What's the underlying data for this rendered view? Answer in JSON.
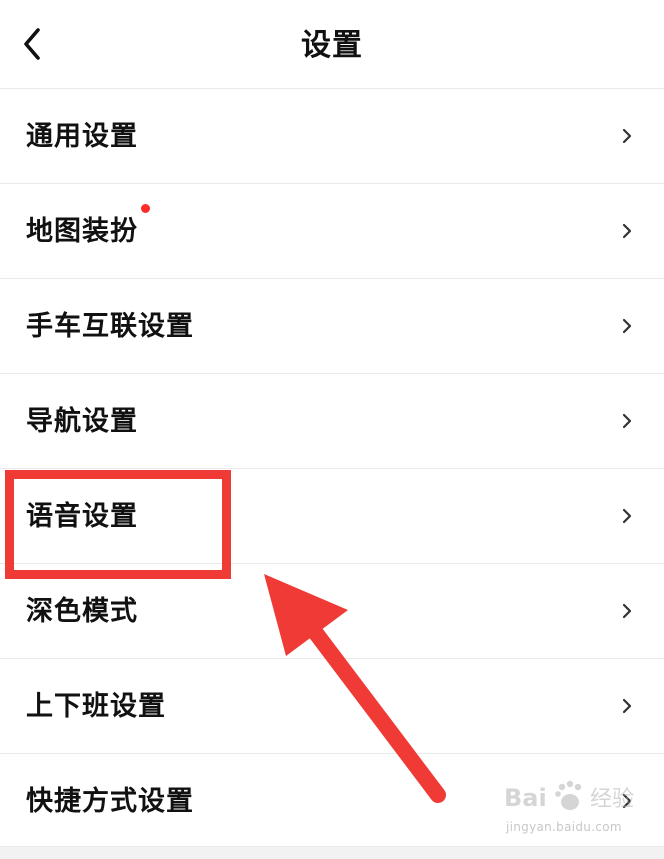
{
  "header": {
    "title": "设置"
  },
  "menu": {
    "items": [
      {
        "label": "通用设置"
      },
      {
        "label": "地图装扮",
        "has_dot": true
      },
      {
        "label": "手车互联设置"
      },
      {
        "label": "导航设置"
      },
      {
        "label": "语音设置"
      },
      {
        "label": "深色模式"
      },
      {
        "label": "上下班设置"
      },
      {
        "label": "快捷方式设置"
      }
    ]
  },
  "annotation": {
    "highlight_color": "#f03a35",
    "highlighted_item": "语音设置"
  },
  "watermark": {
    "logo_text": "Baidu 经验",
    "url": "jingyan.baidu.com"
  },
  "icons": {
    "back": "back-arrow-icon",
    "chevron": "chevron-right-icon",
    "notification": "red-dot-badge"
  },
  "colors": {
    "background": "#ffffff",
    "divider": "#e9e9e9",
    "text": "#111111",
    "badge": "#ff2a2a"
  }
}
